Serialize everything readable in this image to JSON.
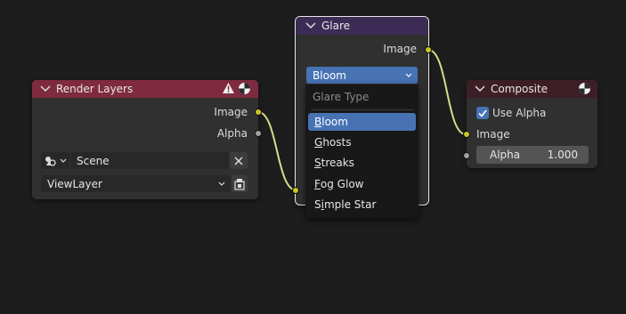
{
  "nodes": {
    "render_layers": {
      "title": "Render Layers",
      "outputs": [
        "Image",
        "Alpha"
      ],
      "scene_value": "Scene",
      "view_layer_value": "ViewLayer"
    },
    "glare": {
      "title": "Glare",
      "output": "Image",
      "glare_type_value": "Bloom",
      "menu": {
        "title": "Glare Type",
        "items": [
          {
            "label": "Bloom",
            "underline": "B",
            "rest": "loom"
          },
          {
            "label": "Ghosts",
            "underline": "G",
            "rest": "hosts"
          },
          {
            "label": "Streaks",
            "underline": "S",
            "rest": "treaks"
          },
          {
            "label": "Fog Glow",
            "underline": "F",
            "rest": "og Glow"
          },
          {
            "label": "Simple Star",
            "pre": "S",
            "underline": "i",
            "rest": "mple Star"
          }
        ],
        "selected": "Bloom"
      }
    },
    "composite": {
      "title": "Composite",
      "use_alpha_label": "Use Alpha",
      "use_alpha_checked": true,
      "input_image": "Image",
      "alpha_label": "Alpha",
      "alpha_value": "1.000"
    }
  },
  "colors": {
    "background": "#1d1d1d",
    "node_body": "#303030",
    "render_header": "#7f2a3e",
    "glare_header": "#3c2c55",
    "composite_header": "#3e1e26",
    "accent": "#4772b3",
    "socket_color": "#c7c729",
    "link_color": "#d9d98c"
  },
  "icons": [
    "chevron-down-icon",
    "warning-icon",
    "render-sphere-icon",
    "scene-icon",
    "close-icon",
    "view-layer-icon",
    "checkbox-icon"
  ]
}
